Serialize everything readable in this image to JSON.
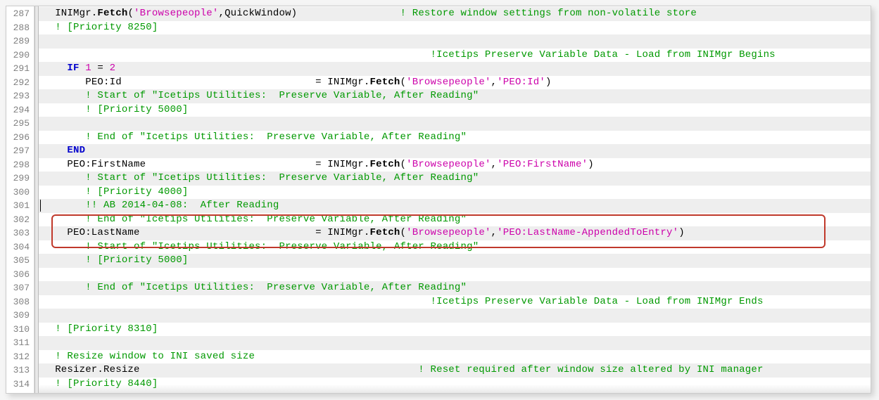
{
  "gutter": {
    "start": 287,
    "end": 314
  },
  "lines": {
    "l287": {
      "indent": "  ",
      "p1": "INIMgr.",
      "fetch": "Fetch",
      "p2": "(",
      "s1": "'Browsepeople'",
      "p3": ",QuickWindow)",
      "pad": "                 ",
      "cmt": "! Restore window settings from non-volatile store"
    },
    "l288": {
      "indent": "  ",
      "cmt": "! [Priority 8250]"
    },
    "l289": "",
    "l290": {
      "indent": "                                                                ",
      "cmt": "!Icetips Preserve Variable Data - Load from INIMgr Begins"
    },
    "l291": {
      "indent": "    ",
      "kw": "IF",
      "sp": " ",
      "n1": "1",
      "eq": " = ",
      "n2": "2"
    },
    "l292": {
      "indent": "       ",
      "lhs": "PEO:Id",
      "pad": "                                ",
      "eq": "= INIMgr.",
      "fetch": "Fetch",
      "op": "(",
      "s1": "'Browsepeople'",
      "cm": ",",
      "s2": "'PEO:Id'",
      "cp": ")"
    },
    "l293": {
      "indent": "       ",
      "cmt": "! Start of \"Icetips Utilities:  Preserve Variable, After Reading\""
    },
    "l294": {
      "indent": "       ",
      "cmt": "! [Priority 5000]"
    },
    "l295": "",
    "l296": {
      "indent": "       ",
      "cmt": "! End of \"Icetips Utilities:  Preserve Variable, After Reading\""
    },
    "l297": {
      "indent": "    ",
      "kw": "END"
    },
    "l298": {
      "indent": "    ",
      "lhs": "PEO:FirstName",
      "pad": "                            ",
      "eq": "= INIMgr.",
      "fetch": "Fetch",
      "op": "(",
      "s1": "'Browsepeople'",
      "cm": ",",
      "s2": "'PEO:FirstName'",
      "cp": ")"
    },
    "l299": {
      "indent": "       ",
      "cmt": "! Start of \"Icetips Utilities:  Preserve Variable, After Reading\""
    },
    "l300": {
      "indent": "       ",
      "cmt": "! [Priority 4000]"
    },
    "l301": {
      "indent": "       ",
      "cmt": "!! AB 2014-04-08:  After Reading"
    },
    "l302": {
      "indent": "       ",
      "cmt": "! End of \"Icetips Utilities:  Preserve Variable, After Reading\""
    },
    "l303": {
      "indent": "    ",
      "lhs": "PEO:LastName",
      "pad": "                             ",
      "eq": "= INIMgr.",
      "fetch": "Fetch",
      "op": "(",
      "s1": "'Browsepeople'",
      "cm": ",",
      "s2": "'PEO:LastName-AppendedToEntry'",
      "cp": ")"
    },
    "l304": {
      "indent": "       ",
      "cmt": "! Start of \"Icetips Utilities:  Preserve Variable, After Reading\""
    },
    "l305": {
      "indent": "       ",
      "cmt": "! [Priority 5000]"
    },
    "l306": "",
    "l307": {
      "indent": "       ",
      "cmt": "! End of \"Icetips Utilities:  Preserve Variable, After Reading\""
    },
    "l308": {
      "indent": "                                                                ",
      "cmt": "!Icetips Preserve Variable Data - Load from INIMgr Ends"
    },
    "l309": "",
    "l310": {
      "indent": "  ",
      "cmt": "! [Priority 8310]"
    },
    "l311": "",
    "l312": {
      "indent": "  ",
      "cmt": "! Resize window to INI saved size"
    },
    "l313": {
      "indent": "  ",
      "lhs": "Resizer.Resize",
      "pad": "                                              ",
      "cmt": "! Reset required after window size altered by INI manager"
    },
    "l314": {
      "indent": "  ",
      "cmt": "! [Priority 8440]"
    }
  }
}
